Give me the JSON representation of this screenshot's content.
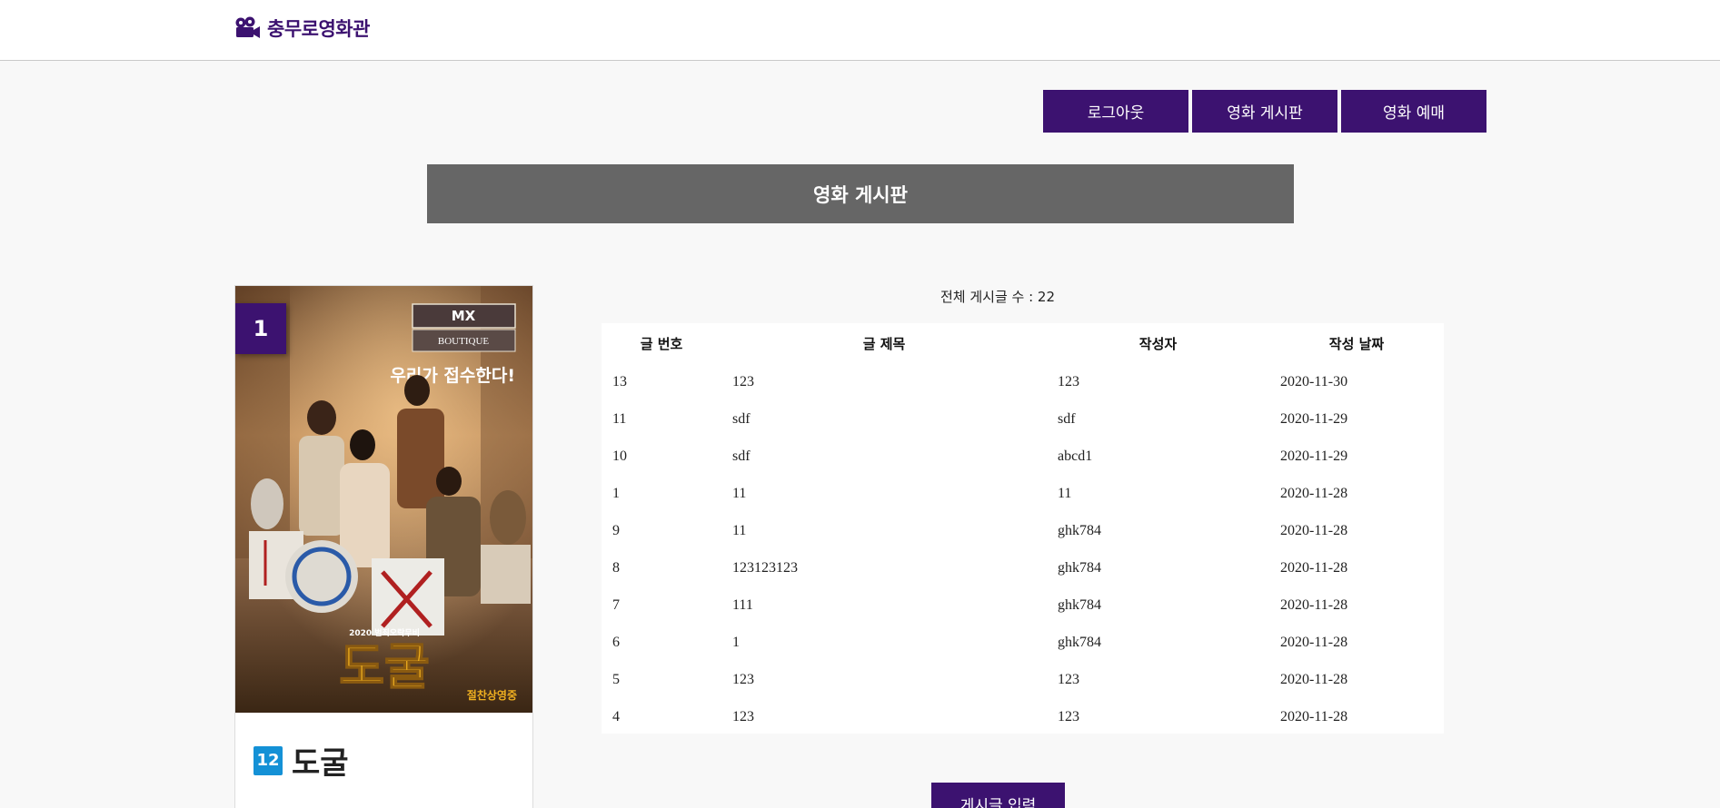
{
  "header": {
    "logo_text": "충무로영화관",
    "logo_icon": "movie-camera-icon"
  },
  "nav": {
    "logout": "로그아웃",
    "board": "영화 게시판",
    "booking": "영화 예매"
  },
  "board": {
    "title": "영화 게시판",
    "post_count_label": "전체 게시글 수 : 22",
    "columns": [
      "글 번호",
      "글 제목",
      "작성자",
      "작성 날짜"
    ],
    "rows": [
      [
        "13",
        "123",
        "123",
        "2020-11-30"
      ],
      [
        "11",
        "sdf",
        "sdf",
        "2020-11-29"
      ],
      [
        "10",
        "sdf",
        "abcd1",
        "2020-11-29"
      ],
      [
        "1",
        "11",
        "11",
        "2020-11-28"
      ],
      [
        "9",
        "11",
        "ghk784",
        "2020-11-28"
      ],
      [
        "8",
        "123123123",
        "ghk784",
        "2020-11-28"
      ],
      [
        "7",
        "111",
        "ghk784",
        "2020-11-28"
      ],
      [
        "6",
        "1",
        "ghk784",
        "2020-11-28"
      ],
      [
        "5",
        "123",
        "123",
        "2020-11-28"
      ],
      [
        "4",
        "123",
        "123",
        "2020-11-28"
      ]
    ],
    "write_button": "게시글 입력"
  },
  "movie": {
    "rank": "1",
    "age_rating": "12",
    "title": "도굴",
    "poster_title": "도굴",
    "poster_tagline": "우리가 접수한다!",
    "poster_top": "MX",
    "poster_sign": "BOUTIQUE",
    "poster_year": "2020 범죄오락무비",
    "poster_release": "절찬상영중"
  },
  "colors": {
    "brand": "#3c1270",
    "title_bar": "#666666",
    "age_badge": "#1491d6"
  }
}
